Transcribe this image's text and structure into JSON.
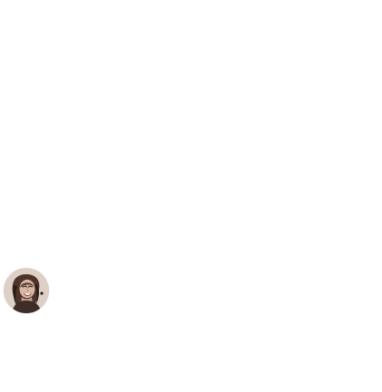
{
  "profile": {
    "avatar_icon": "avatar-photo"
  }
}
